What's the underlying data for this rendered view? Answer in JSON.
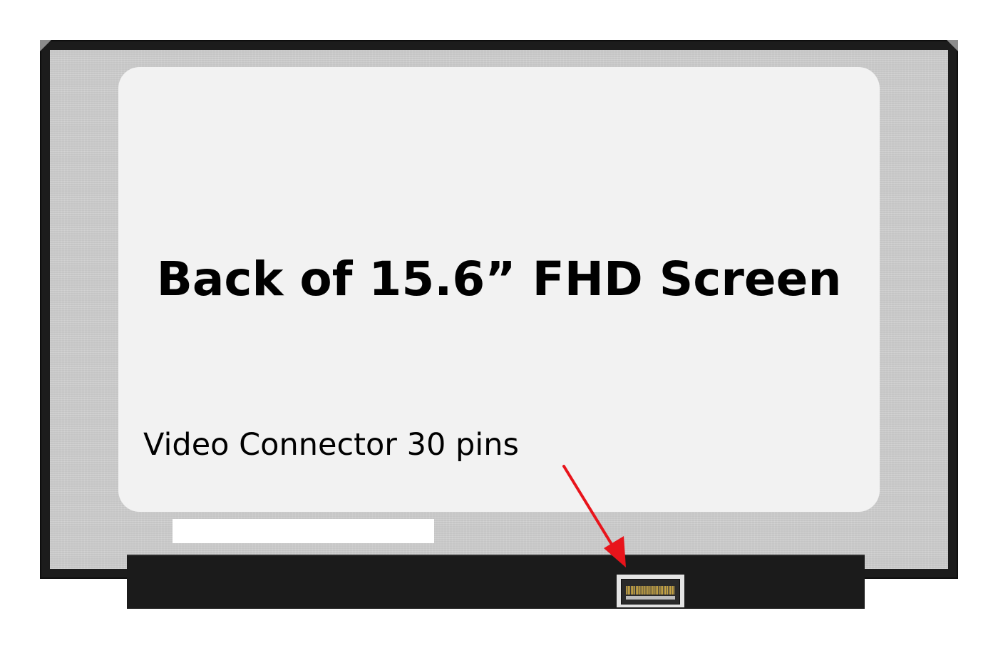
{
  "headline": "Back of 15.6” FHD Screen",
  "caption": "Video Connector 30 pins",
  "colors": {
    "frame": "#1c1c1c",
    "panel": "#cfcfcf",
    "label_area": "#f2f2f2",
    "arrow": "#e8141b"
  },
  "icons": {
    "connector": "video-connector-icon",
    "pointer": "red-arrow-icon"
  }
}
